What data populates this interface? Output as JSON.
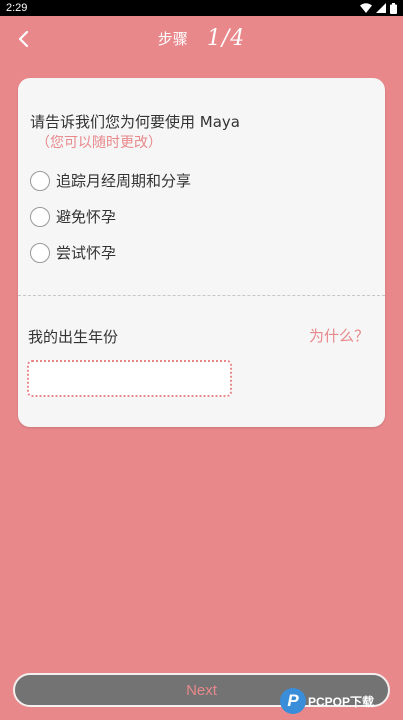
{
  "status": {
    "time": "2:29"
  },
  "header": {
    "step_label": "步骤",
    "step_count": "1/4"
  },
  "card": {
    "question": "请告诉我们您为何要使用 Maya",
    "note": "（您可以随时更改）",
    "options": [
      {
        "label": "追踪月经周期和分享"
      },
      {
        "label": "避免怀孕"
      },
      {
        "label": "尝试怀孕"
      }
    ],
    "birth_year_label": "我的出生年份",
    "why_link": "为什么？",
    "birth_year_value": ""
  },
  "footer": {
    "next_label": "Next"
  },
  "watermark": {
    "logo_letter": "P",
    "text": "PCPOP下载"
  },
  "colors": {
    "background": "#e8888b",
    "accent": "#e8888b",
    "card": "#f6f6f6",
    "button": "#737373"
  }
}
